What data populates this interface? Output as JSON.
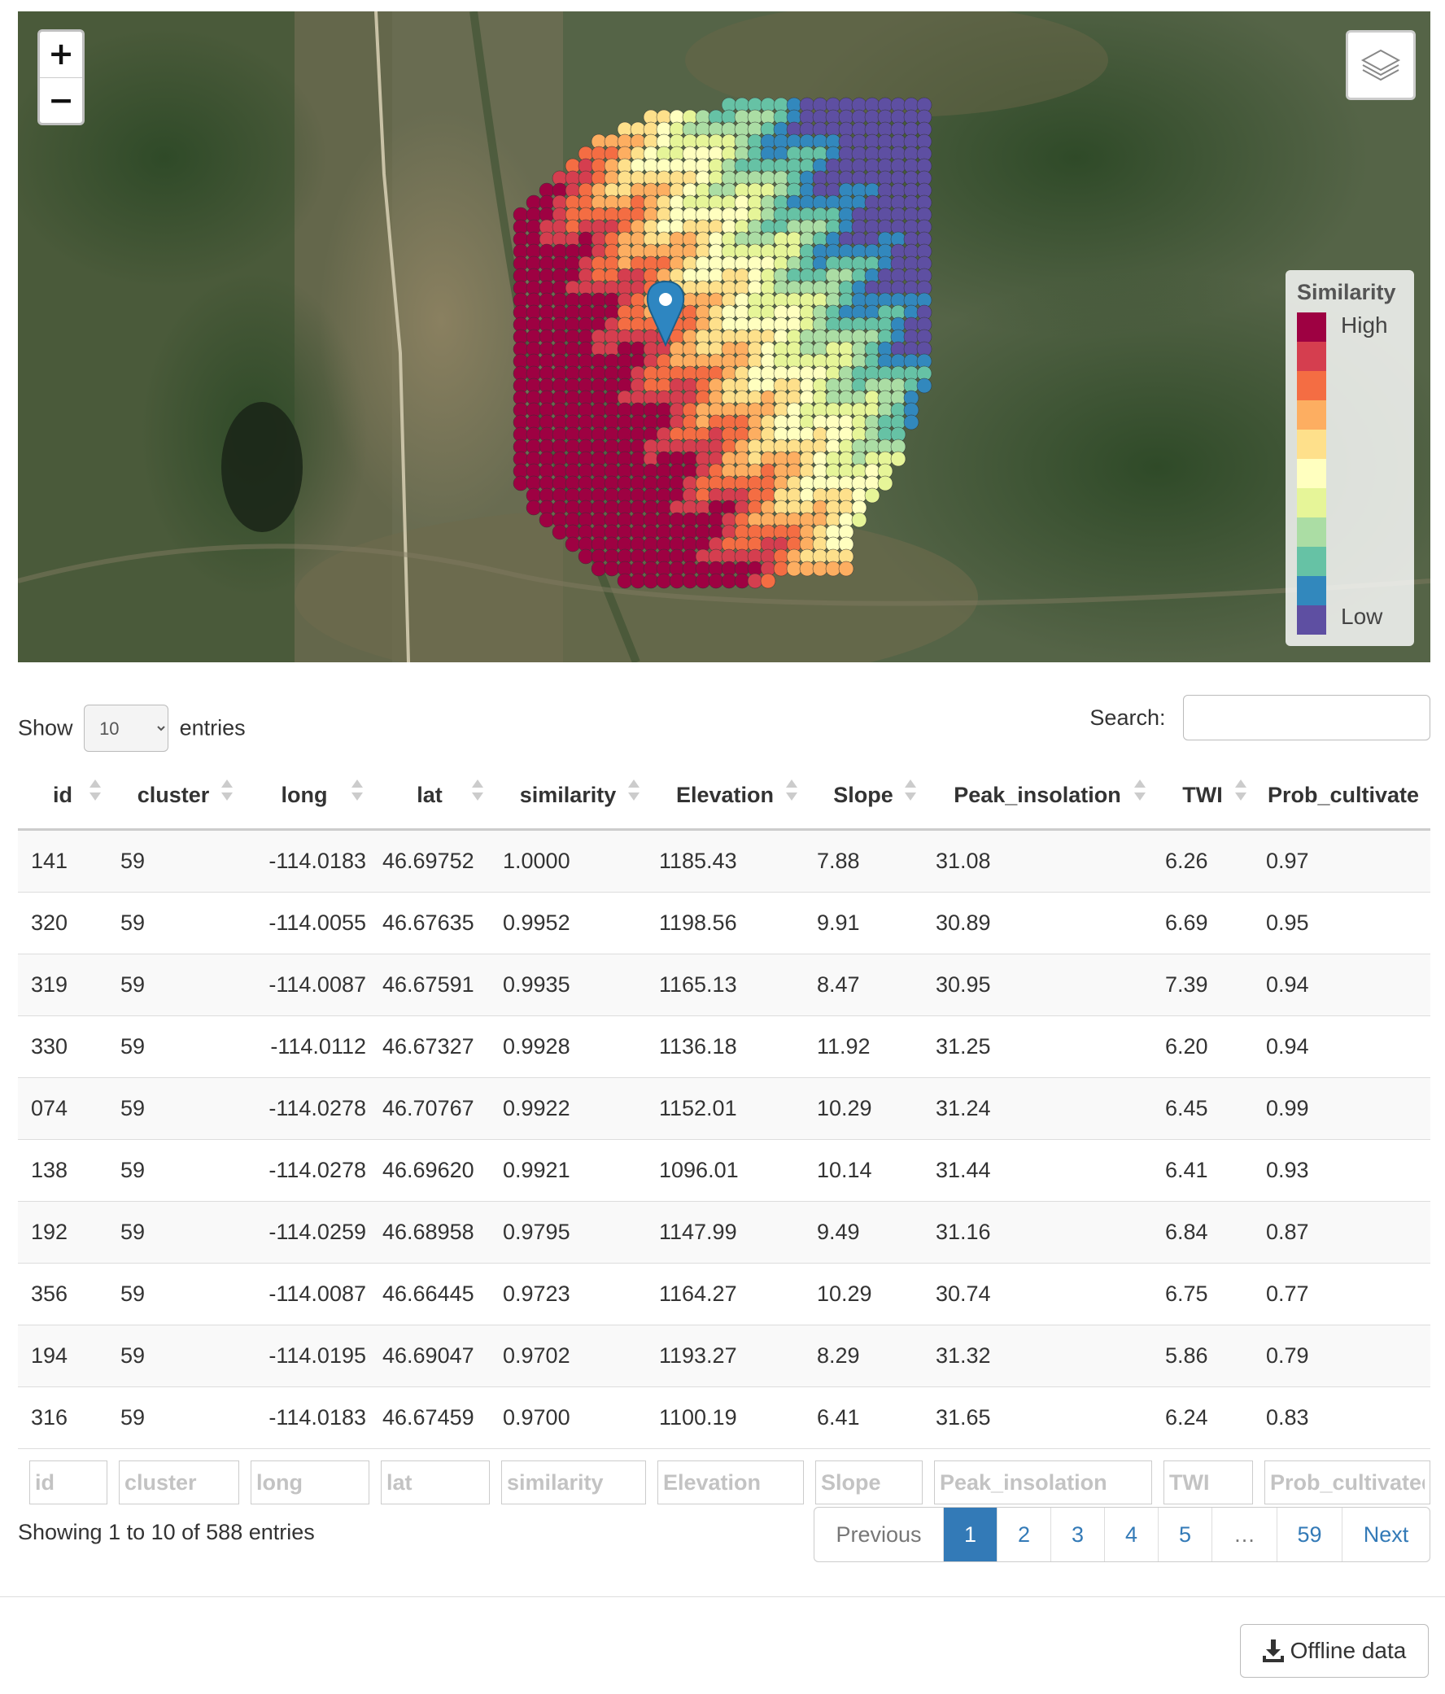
{
  "map": {
    "zoom_in": "+",
    "zoom_out": "−",
    "layers_icon": "layers-icon",
    "marker_icon": "map-marker-icon",
    "legend": {
      "title": "Similarity",
      "high_label": "High",
      "low_label": "Low",
      "colors": [
        "#9e0142",
        "#d53e4f",
        "#f46d43",
        "#fdae61",
        "#fee08b",
        "#ffffbf",
        "#e6f598",
        "#abdda4",
        "#66c2a5",
        "#3288bd",
        "#5e4fa2"
      ]
    }
  },
  "controls": {
    "show_label": "Show",
    "page_size": "10",
    "entries_label": "entries",
    "search_label": "Search:"
  },
  "table": {
    "columns": [
      "id",
      "cluster",
      "long",
      "lat",
      "similarity",
      "Elevation",
      "Slope",
      "Peak_insolation",
      "TWI",
      "Prob_cultivate"
    ],
    "rows": [
      [
        "141",
        "59",
        "-114.0183",
        "46.69752",
        "1.0000",
        "1185.43",
        "7.88",
        "31.08",
        "6.26",
        "0.97"
      ],
      [
        "320",
        "59",
        "-114.0055",
        "46.67635",
        "0.9952",
        "1198.56",
        "9.91",
        "30.89",
        "6.69",
        "0.95"
      ],
      [
        "319",
        "59",
        "-114.0087",
        "46.67591",
        "0.9935",
        "1165.13",
        "8.47",
        "30.95",
        "7.39",
        "0.94"
      ],
      [
        "330",
        "59",
        "-114.0112",
        "46.67327",
        "0.9928",
        "1136.18",
        "11.92",
        "31.25",
        "6.20",
        "0.94"
      ],
      [
        "074",
        "59",
        "-114.0278",
        "46.70767",
        "0.9922",
        "1152.01",
        "10.29",
        "31.24",
        "6.45",
        "0.99"
      ],
      [
        "138",
        "59",
        "-114.0278",
        "46.69620",
        "0.9921",
        "1096.01",
        "10.14",
        "31.44",
        "6.41",
        "0.93"
      ],
      [
        "192",
        "59",
        "-114.0259",
        "46.68958",
        "0.9795",
        "1147.99",
        "9.49",
        "31.16",
        "6.84",
        "0.87"
      ],
      [
        "356",
        "59",
        "-114.0087",
        "46.66445",
        "0.9723",
        "1164.27",
        "10.29",
        "30.74",
        "6.75",
        "0.77"
      ],
      [
        "194",
        "59",
        "-114.0195",
        "46.69047",
        "0.9702",
        "1193.27",
        "8.29",
        "31.32",
        "5.86",
        "0.79"
      ],
      [
        "316",
        "59",
        "-114.0183",
        "46.67459",
        "0.9700",
        "1100.19",
        "6.41",
        "31.65",
        "6.24",
        "0.83"
      ]
    ],
    "filters": [
      "id",
      "cluster",
      "long",
      "lat",
      "similarity",
      "Elevation",
      "Slope",
      "Peak_insolation",
      "TWI",
      "Prob_cultivated"
    ]
  },
  "info": "Showing 1 to 10 of 588 entries",
  "pagination": {
    "previous": "Previous",
    "pages": [
      "1",
      "2",
      "3",
      "4",
      "5"
    ],
    "ellipsis": "…",
    "last": "59",
    "next": "Next",
    "active": "1"
  },
  "download": {
    "label": "Offline data",
    "icon": "download-icon"
  }
}
